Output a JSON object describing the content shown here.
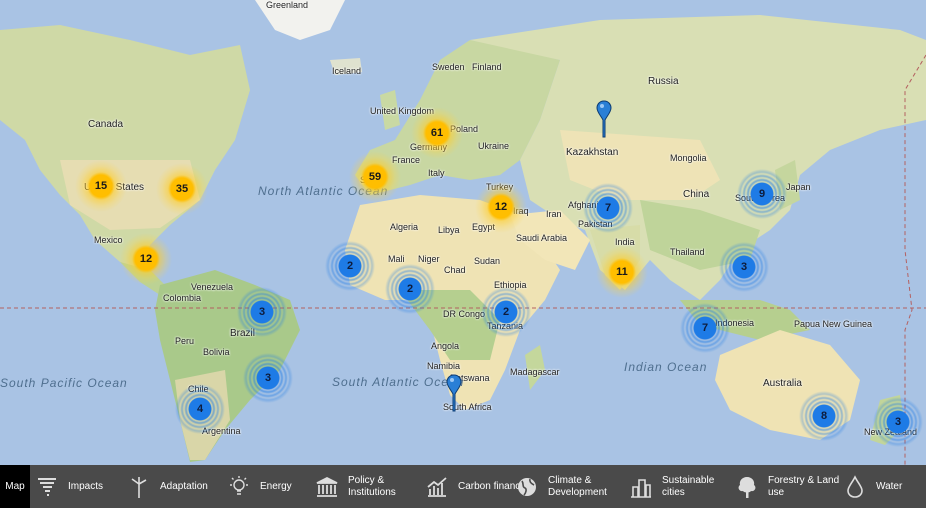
{
  "map": {
    "countries": [
      "Greenland",
      "Iceland",
      "Sweden",
      "Finland",
      "Russia",
      "United Kingdom",
      "Poland",
      "Germany",
      "Ukraine",
      "France",
      "Spain",
      "Italy",
      "Kazakhstan",
      "Mongolia",
      "Turkey",
      "Iraq",
      "Iran",
      "Afghanistan",
      "Pakistan",
      "China",
      "Japan",
      "South Korea",
      "Canada",
      "United States",
      "Mexico",
      "Algeria",
      "Libya",
      "Egypt",
      "Saudi Arabia",
      "India",
      "Thailand",
      "Mali",
      "Niger",
      "Chad",
      "Sudan",
      "Ethiopia",
      "Venezuela",
      "Colombia",
      "Brazil",
      "Peru",
      "Bolivia",
      "Chile",
      "Argentina",
      "DR Congo",
      "Tanzania",
      "Indonesia",
      "Papua New Guinea",
      "Angola",
      "Namibia",
      "Botswana",
      "Madagascar",
      "South Africa",
      "Australia",
      "New Zealand"
    ],
    "oceans": [
      "North Atlantic Ocean",
      "South Atlantic Ocean",
      "Indian Ocean",
      "South Pacific Ocean"
    ],
    "clusters": [
      {
        "count": "15",
        "color": "yellow"
      },
      {
        "count": "35",
        "color": "yellow"
      },
      {
        "count": "12",
        "color": "yellow"
      },
      {
        "count": "61",
        "color": "yellow"
      },
      {
        "count": "59",
        "color": "yellow"
      },
      {
        "count": "12",
        "color": "yellow"
      },
      {
        "count": "11",
        "color": "yellow"
      },
      {
        "count": "7",
        "color": "blue"
      },
      {
        "count": "9",
        "color": "blue"
      },
      {
        "count": "3",
        "color": "blue"
      },
      {
        "count": "2",
        "color": "blue"
      },
      {
        "count": "2",
        "color": "blue"
      },
      {
        "count": "2",
        "color": "blue"
      },
      {
        "count": "3",
        "color": "blue"
      },
      {
        "count": "3",
        "color": "blue"
      },
      {
        "count": "4",
        "color": "blue"
      },
      {
        "count": "7",
        "color": "blue"
      },
      {
        "count": "8",
        "color": "blue"
      },
      {
        "count": "3",
        "color": "blue"
      }
    ],
    "pins": [
      "Kazakhstan",
      "South Africa"
    ]
  },
  "toolbar": {
    "items": [
      {
        "label": "Map",
        "icon": "map-icon"
      },
      {
        "label": "Impacts",
        "icon": "tornado-icon"
      },
      {
        "label": "Adaptation",
        "icon": "wind-turbine-icon"
      },
      {
        "label": "Energy",
        "icon": "lightbulb-icon"
      },
      {
        "label": "Policy & Institutions",
        "icon": "institution-icon"
      },
      {
        "label": "Carbon finance",
        "icon": "finance-chart-icon"
      },
      {
        "label": "Climate & Development",
        "icon": "globe-icon"
      },
      {
        "label": "Sustainable cities",
        "icon": "city-icon"
      },
      {
        "label": "Forestry & Land use",
        "icon": "tree-icon"
      },
      {
        "label": "Water",
        "icon": "water-drop-icon"
      }
    ]
  },
  "colors": {
    "ocean": "#a9c3e4",
    "land": "#e9e5c8",
    "forest": "#b9cf95",
    "desert": "#f0e4b4",
    "toolbar": "#4a4a4a",
    "cluster_yellow": "#ffbe00",
    "cluster_blue": "#1e7be6"
  }
}
